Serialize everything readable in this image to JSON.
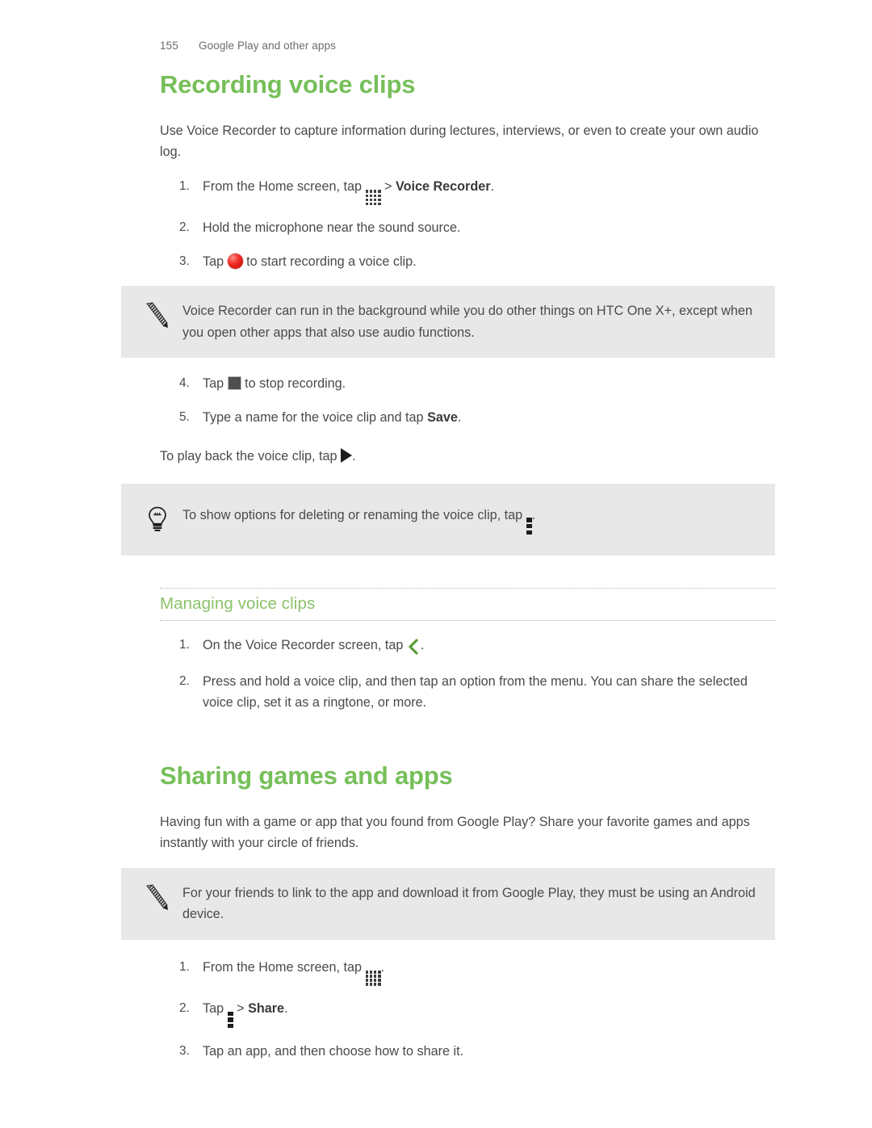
{
  "header": {
    "page_number": "155",
    "chapter": "Google Play and other apps"
  },
  "sections": [
    {
      "title": "Recording voice clips",
      "intro": "Use Voice Recorder to capture information during lectures, interviews, or even to create your own audio log.",
      "steps_a": [
        {
          "num": "1.",
          "pre": "From the Home screen, tap ",
          "icon": "apps-grid-icon",
          "mid": " > ",
          "bold": "Voice Recorder",
          "post": "."
        },
        {
          "num": "2.",
          "pre": "Hold the microphone near the sound source.",
          "icon": "",
          "mid": "",
          "bold": "",
          "post": ""
        },
        {
          "num": "3.",
          "pre": "Tap ",
          "icon": "record-button-icon",
          "mid": " to start recording a voice clip.",
          "bold": "",
          "post": ""
        }
      ],
      "note": "Voice Recorder can run in the background while you do other things on HTC One X+, except when you open other apps that also use audio functions.",
      "steps_b": [
        {
          "num": "4.",
          "pre": "Tap ",
          "icon": "stop-button-icon",
          "mid": " to stop recording.",
          "bold": "",
          "post": ""
        },
        {
          "num": "5.",
          "pre": "Type a name for the voice clip and tap ",
          "icon": "",
          "mid": "",
          "bold": "Save",
          "post": "."
        }
      ],
      "playback_pre": "To play back the voice clip, tap ",
      "playback_icon": "play-button-icon",
      "playback_post": ".",
      "tip_pre": "To show options for deleting or renaming the voice clip, tap ",
      "tip_icon": "overflow-menu-icon",
      "tip_post": ".",
      "subsection": {
        "title": "Managing voice clips",
        "steps": [
          {
            "num": "1.",
            "pre": "On the Voice Recorder screen, tap ",
            "icon": "back-chevron-icon",
            "mid": ".",
            "bold": "",
            "post": ""
          },
          {
            "num": "2.",
            "pre": "Press and hold a voice clip, and then tap an option from the menu. You can share the selected voice clip, set it as a ringtone, or more.",
            "icon": "",
            "mid": "",
            "bold": "",
            "post": ""
          }
        ]
      }
    },
    {
      "title": "Sharing games and apps",
      "intro": "Having fun with a game or app that you found from Google Play? Share your favorite games and apps instantly with your circle of friends.",
      "note": "For your friends to link to the app and download it from Google Play, they must be using an Android device.",
      "steps": [
        {
          "num": "1.",
          "pre": "From the Home screen, tap ",
          "icon": "apps-grid-icon",
          "mid": ".",
          "bold": "",
          "post": ""
        },
        {
          "num": "2.",
          "pre": "Tap ",
          "icon": "overflow-menu-icon",
          "mid": " > ",
          "bold": "Share",
          "post": "."
        },
        {
          "num": "3.",
          "pre": "Tap an app, and then choose how to share it.",
          "icon": "",
          "mid": "",
          "bold": "",
          "post": ""
        }
      ]
    }
  ],
  "colors": {
    "heading_green": "#76bf59",
    "subheading_green": "#8cc26a",
    "callout_bg": "#e8e8e8",
    "body_text": "#4a4a4a",
    "record_red": "#ef2b22",
    "chevron_green": "#5a9e3a"
  },
  "icons": {
    "apps_grid": "apps-grid-icon",
    "record": "record-button-icon",
    "stop": "stop-button-icon",
    "play": "play-button-icon",
    "overflow": "overflow-menu-icon",
    "back": "back-chevron-icon",
    "note_pencil": "pencil-icon",
    "tip_bulb": "lightbulb-icon"
  }
}
